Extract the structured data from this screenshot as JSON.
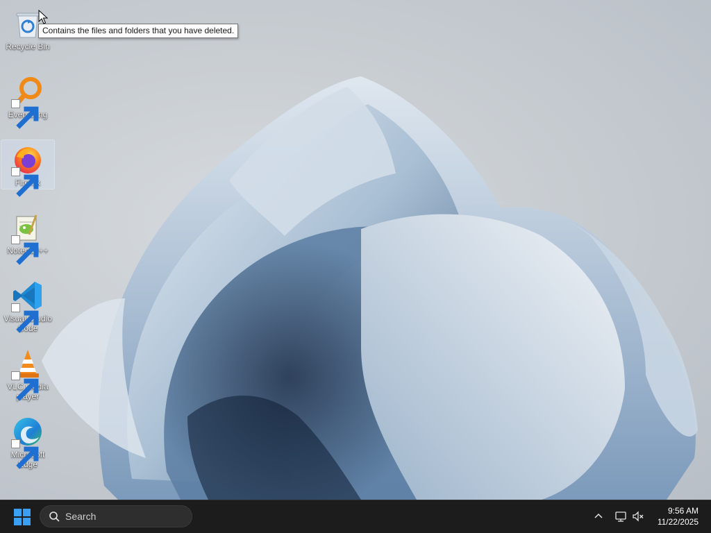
{
  "desktop": {
    "icons": [
      {
        "label": "Recycle Bin",
        "icon": "recycle-bin-icon"
      },
      {
        "label": "Everything",
        "icon": "everything-icon"
      },
      {
        "label": "Firefox",
        "icon": "firefox-icon"
      },
      {
        "label": "Notepad++",
        "icon": "notepadpp-icon"
      },
      {
        "label": "Visual Studio Code",
        "icon": "vscode-icon"
      },
      {
        "label": "VLC media player",
        "icon": "vlc-icon"
      },
      {
        "label": "Microsoft Edge",
        "icon": "edge-icon"
      }
    ],
    "tooltip": "Contains the files and folders that you have deleted."
  },
  "taskbar": {
    "search_placeholder": "Search",
    "clock": {
      "time": "9:56 AM",
      "date": "11/22/2025"
    }
  },
  "colors": {
    "taskbar_bg": "#1c1c1c",
    "start_accent": "#3aa0f3",
    "wallpaper_blue": "#6e93b8"
  }
}
